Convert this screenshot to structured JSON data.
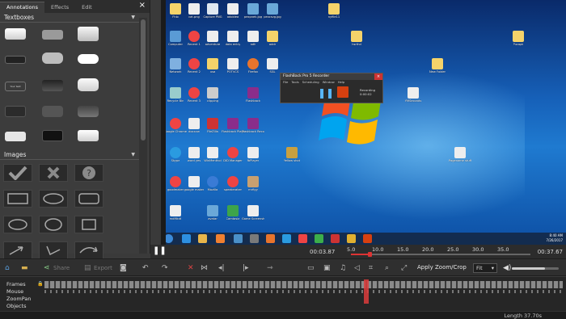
{
  "panel": {
    "tabs": [
      "Annotations",
      "Effects",
      "Edit"
    ],
    "close": "×",
    "textboxes_header": "Textboxes",
    "images_header": "Images",
    "textbox_label": "Your text"
  },
  "desktop": {
    "icons": [
      "Fhlo",
      "cat.png",
      "Capture PNG",
      "adoblea",
      "pexpnek.jpg",
      "pexcsvg.jpg",
      "nyfile11",
      "Computer",
      "Recent 1",
      "adventure",
      "data entry",
      "adh",
      "addr",
      "hsrthd",
      "Pucapk",
      "Network",
      "Recent 2",
      "usa",
      "POTVCS",
      "Firefox",
      "SGL",
      "New Folder",
      "Recycle Bin",
      "Recent 3",
      "clipping",
      "Flashback",
      "YMSeconds",
      "Google Chrome",
      "docxvw",
      "FileZilla",
      "Flashback Player",
      "Flashback Recorder",
      "Skype",
      "word yes",
      "WinMenthol",
      "DID Manager",
      "fbPlayer",
      "Yellow shot",
      "Pagename stuff",
      "goodmaker",
      "google maker",
      "Mozilla",
      "speakeraker",
      "mrfigy",
      "mdMkdt",
      "avatar",
      "Camtasia",
      "Game Screenshot"
    ],
    "recorder": {
      "title": "FlashBack Pro 5 Recorder",
      "menu": [
        "File",
        "Tools",
        "Scheduling",
        "Window",
        "Help"
      ],
      "status_label": "Recording",
      "status_time": "0:00:02"
    },
    "clock": {
      "time": "8:40 AM",
      "date": "7/26/2017"
    }
  },
  "transport": {
    "current_time": "00:03.87",
    "end_time": "00:37.67",
    "ticks": [
      "5.0",
      "10.0",
      "15.0",
      "20.0",
      "25.0",
      "30.0",
      "35.0"
    ],
    "progress": 0.103
  },
  "toolbar": {
    "share_label": "Share",
    "export_label": "Export",
    "apply_zoom_crop": "Apply Zoom/Crop",
    "fit": "Fit",
    "volume": 0.7
  },
  "timeline": {
    "tracks": [
      "Frames",
      "Mouse",
      "ZoomPan",
      "Objects"
    ]
  },
  "status": {
    "length": "Length 37.70s"
  },
  "colors": {
    "accent": "#d33333",
    "recorder_record": "#d64010",
    "bg": "#3a3a3a"
  }
}
